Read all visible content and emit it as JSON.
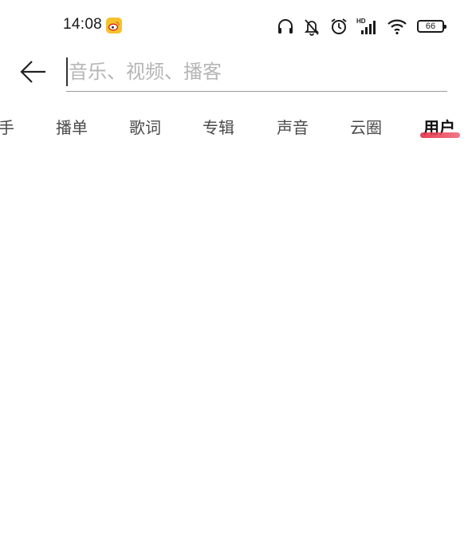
{
  "status_bar": {
    "time": "14:08",
    "battery": "66",
    "icons": [
      "weibo-icon",
      "headphones-icon",
      "mute-icon",
      "alarm-icon",
      "hd-signal-icon",
      "wifi-icon",
      "battery-icon"
    ]
  },
  "search": {
    "placeholder": "音乐、视频、播客",
    "value": ""
  },
  "tabs": [
    {
      "label": "手"
    },
    {
      "label": "播单"
    },
    {
      "label": "歌词"
    },
    {
      "label": "专辑"
    },
    {
      "label": "声音"
    },
    {
      "label": "云圈"
    },
    {
      "label": "用户"
    }
  ],
  "active_tab": "用户",
  "colors": {
    "accent": "#e52b45",
    "weibo_yellow": "#f6c22b"
  }
}
